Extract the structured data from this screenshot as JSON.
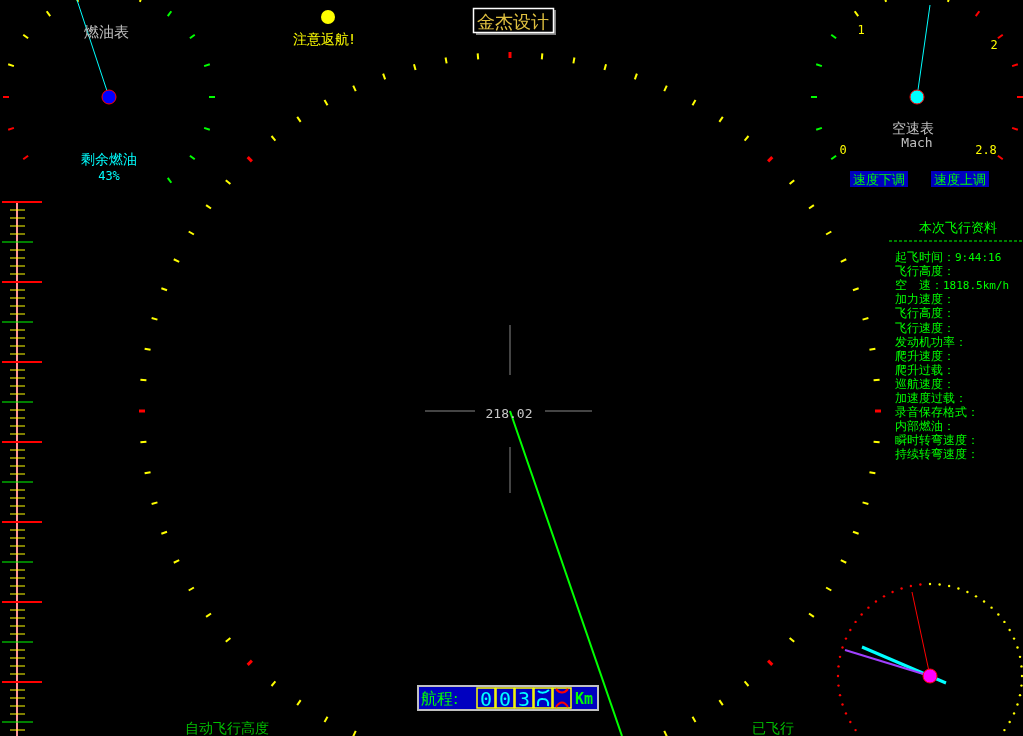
{
  "logo": "金杰设计",
  "warning": {
    "text": "注意返航!"
  },
  "fuel_gauge": {
    "title": "燃油表",
    "label": "剩余燃油",
    "reading": "43%"
  },
  "airspeed_gauge": {
    "title": "空速表",
    "unit": "Mach",
    "scale_labels": [
      "0",
      "1",
      "2",
      "2.8"
    ]
  },
  "speed_buttons": [
    "速度下调",
    "速度上调"
  ],
  "flight_data": {
    "title": "本次飞行资料",
    "rows": [
      {
        "label": "起飞时间：",
        "value": "9:44:16"
      },
      {
        "label": "飞行高度："
      },
      {
        "label": "空　速：",
        "value": "1818.5km/h"
      },
      {
        "label": "加力速度："
      },
      {
        "label": "飞行高度："
      },
      {
        "label": "飞行速度："
      },
      {
        "label": "发动机功率："
      },
      {
        "label": "爬升速度："
      },
      {
        "label": "爬升过载："
      },
      {
        "label": "巡航速度："
      },
      {
        "label": "加速度过载："
      },
      {
        "label": "录音保存格式："
      },
      {
        "label": "内部燃油："
      },
      {
        "label": "瞬时转弯速度："
      },
      {
        "label": "持续转弯速度："
      }
    ]
  },
  "heading": {
    "reading": "218.02"
  },
  "range_counter": {
    "label": "航程:",
    "digits": [
      "0",
      "0",
      "3"
    ],
    "unit": "Km"
  },
  "bottom_labels": [
    "自动飞行高度",
    "已飞行"
  ]
}
